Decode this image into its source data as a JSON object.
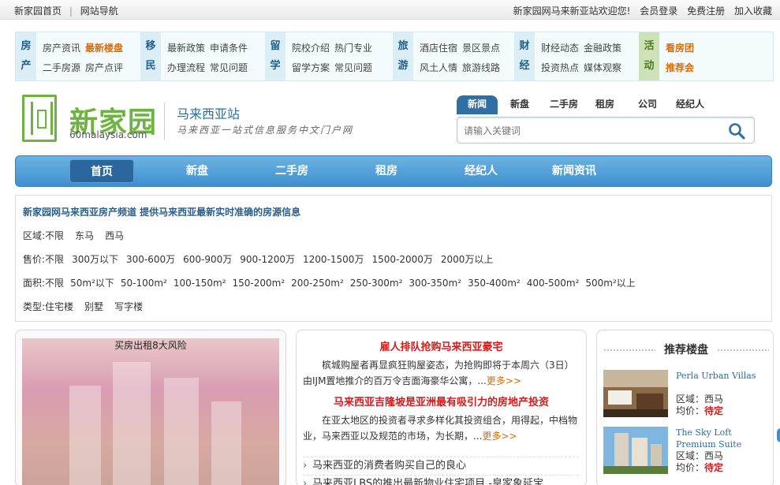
{
  "topbar": {
    "home": "新家园首页",
    "sep": "|",
    "nav": "网站导航",
    "welcome": "新家园网马来新亚站欢迎您!",
    "login": "会员登录",
    "register": "免费注册",
    "favorite": "加入收藏"
  },
  "categories": [
    {
      "tag1": "房",
      "tag2": "产",
      "links": [
        "房产资讯",
        "最新楼盘",
        "二手房源",
        "房产点评"
      ],
      "hot": [
        1
      ]
    },
    {
      "tag1": "移",
      "tag2": "民",
      "links": [
        "最新政策",
        "申请条件",
        "办理流程",
        "常见问题"
      ],
      "hot": []
    },
    {
      "tag1": "留",
      "tag2": "学",
      "links": [
        "院校介绍",
        "热门专业",
        "留学方案",
        "常见问题"
      ],
      "hot": []
    },
    {
      "tag1": "旅",
      "tag2": "游",
      "links": [
        "酒店住宿",
        "景区景点",
        "风土人情",
        "旅游线路"
      ],
      "hot": []
    },
    {
      "tag1": "财",
      "tag2": "经",
      "links": [
        "财经动态",
        "金融政策",
        "投资热点",
        "媒体观察"
      ],
      "hot": []
    },
    {
      "tag1": "活",
      "tag2": "动",
      "links": [
        "看房团",
        "推荐会"
      ],
      "hot": []
    }
  ],
  "logo": {
    "text": "新家园",
    "url": "60malaysia.com",
    "site_name": "马来西亚站",
    "slogan": "马来西亚一站式信息服务中文门户网"
  },
  "search": {
    "tabs": [
      "新闻",
      "新盘",
      "二手房",
      "租房",
      "公司",
      "经纪人"
    ],
    "active_tab": "新闻",
    "placeholder": "请输入关键词",
    "icon": "search-icon"
  },
  "mainnav": {
    "items": [
      "首页",
      "新盘",
      "二手房",
      "租房",
      "经纪人",
      "新闻资讯"
    ],
    "active": "首页"
  },
  "filter": {
    "headline": "新家园网马来西亚房产频道 提供马来西亚最新实时准确的房源信息",
    "region": {
      "label": "区域:",
      "options": [
        "不限",
        "东马",
        "西马"
      ]
    },
    "price": {
      "label": "售价:",
      "options": [
        "不限",
        "300万以下",
        "300-600万",
        "600-900万",
        "900-1200万",
        "1200-1500万",
        "1500-2000万",
        "2000万以上"
      ]
    },
    "area": {
      "label": "面积:",
      "options": [
        "不限",
        "50m²以下",
        "50-100m²",
        "100-150m²",
        "150-200m²",
        "200-250m²",
        "250-300m²",
        "300-350m²",
        "350-400m²",
        "400-500m²",
        "500m²以上"
      ]
    },
    "type": {
      "label": "类型:",
      "options": [
        "住宅楼",
        "别墅",
        "写字楼"
      ]
    }
  },
  "imgbox": {
    "caption": "买房出租8大风险"
  },
  "news": {
    "story1_title": "雇人排队抢购马来西亚豪宅",
    "story1_body": "槟城购屋者再显疯狂购屋姿态，为抢购即将于本周六（3日）由IJM置地推介的百万令吉面海豪华公寓，...",
    "story2_title": "马来西亚吉隆坡是亚洲最有吸引力的房地产投资",
    "story2_body": "在亚太地区的投资者寻求多样化其投资组合，用得起，中档物业，马来西亚以及规范的市场，为长期，...",
    "more": "更多>>",
    "list": [
      "马来西亚的消费者购买自己的良心",
      "马来西亚LBS的推出最新物业住宅项目 -皇家象延宝"
    ]
  },
  "recommend": {
    "title": "推荐楼盘",
    "items": [
      {
        "name": "Perla Urban Villas",
        "region_label": "区域：",
        "region": "西马",
        "price_label": "均价：",
        "price": "待定"
      },
      {
        "name": "The Sky Loft Premium Suite",
        "region_label": "区域：",
        "region": "西马",
        "price_label": "均价：",
        "price": "待定"
      }
    ]
  },
  "colors": {
    "accent_blue": "#3f8fcf",
    "logo_green": "#6cb33f",
    "hot_orange": "#e06a00",
    "news_red": "#d71a1a"
  }
}
